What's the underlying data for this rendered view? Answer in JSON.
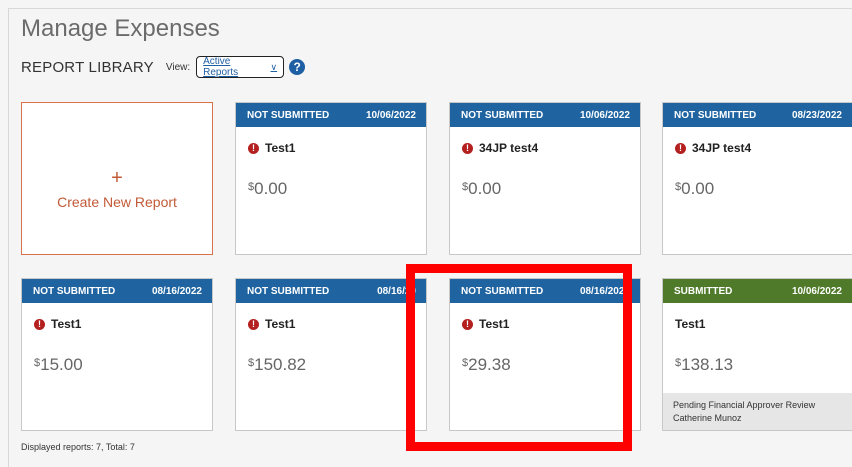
{
  "header": {
    "title": "Manage Expenses"
  },
  "library": {
    "title": "REPORT LIBRARY",
    "view_label": "View:",
    "view_value": "Active Reports",
    "help_glyph": "?"
  },
  "create": {
    "plus": "+",
    "label": "Create New Report"
  },
  "reports": [
    {
      "status": "NOT SUBMITTED",
      "date": "10/06/2022",
      "name": "Test1",
      "currency": "$",
      "amount": "0.00",
      "warning": true
    },
    {
      "status": "NOT SUBMITTED",
      "date": "10/06/2022",
      "name": "34JP test4",
      "currency": "$",
      "amount": "0.00",
      "warning": true
    },
    {
      "status": "NOT SUBMITTED",
      "date": "08/23/2022",
      "name": "34JP test4",
      "currency": "$",
      "amount": "0.00",
      "warning": true
    },
    {
      "status": "NOT SUBMITTED",
      "date": "08/16/2022",
      "name": "Test1",
      "currency": "$",
      "amount": "15.00",
      "warning": true
    },
    {
      "status": "NOT SUBMITTED",
      "date": "08/16/20",
      "name": "Test1",
      "currency": "$",
      "amount": "150.82",
      "warning": true
    },
    {
      "status": "NOT SUBMITTED",
      "date": "08/16/2022",
      "name": "Test1",
      "currency": "$",
      "amount": "29.38",
      "warning": true
    },
    {
      "status": "SUBMITTED",
      "date": "10/06/2022",
      "name": "Test1",
      "currency": "$",
      "amount": "138.13",
      "warning": false,
      "footer_line1": "Pending Financial Approver Review",
      "footer_line2": "Catherine Munoz"
    }
  ],
  "status_bar": {
    "text": "Displayed reports: 7, Total: 7"
  },
  "colors": {
    "header_blue": "#1f64a1",
    "submitted_green": "#4f7a2a",
    "accent_orange": "#c25a37",
    "highlight_red": "#ff0000"
  }
}
